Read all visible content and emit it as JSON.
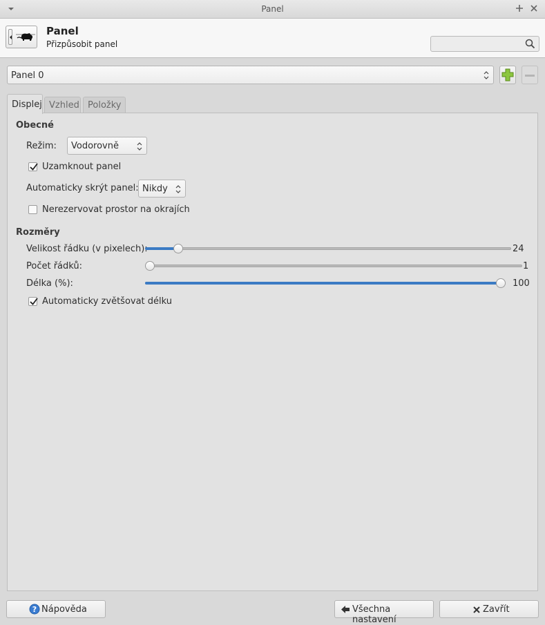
{
  "window": {
    "title": "Panel"
  },
  "header": {
    "title": "Panel",
    "subtitle": "Přizpůsobit panel",
    "search_placeholder": ""
  },
  "panel_selector": {
    "value": "Panel 0"
  },
  "tabs": [
    {
      "label": "Displej",
      "active": true
    },
    {
      "label": "Vzhled",
      "active": false
    },
    {
      "label": "Položky",
      "active": false
    }
  ],
  "general": {
    "heading": "Obecné",
    "mode_label": "Režim:",
    "mode_value": "Vodorovně",
    "lock_label": "Uzamknout panel",
    "lock_checked": true,
    "autohide_label": "Automaticky skrýt panel:",
    "autohide_value": "Nikdy",
    "reserve_label": "Nerezervovat prostor na okrajích",
    "reserve_checked": false
  },
  "dimensions": {
    "heading": "Rozměry",
    "row_size": {
      "label": "Velikost řádku (v pixelech):",
      "value": "24",
      "fraction": 0.08
    },
    "rows": {
      "label": "Počet řádků:",
      "value": "1",
      "fraction": 0.0
    },
    "length": {
      "label": "Délka (%):",
      "value": "100",
      "fraction": 1.0
    },
    "autogrow_label": "Automaticky zvětšovat délku",
    "autogrow_checked": true
  },
  "buttons": {
    "help": "Nápověda",
    "all_settings": "Všechna nastavení",
    "close": "Zavřít"
  },
  "colors": {
    "accent": "#3b7bc4",
    "add_green": "#8cc63f"
  }
}
